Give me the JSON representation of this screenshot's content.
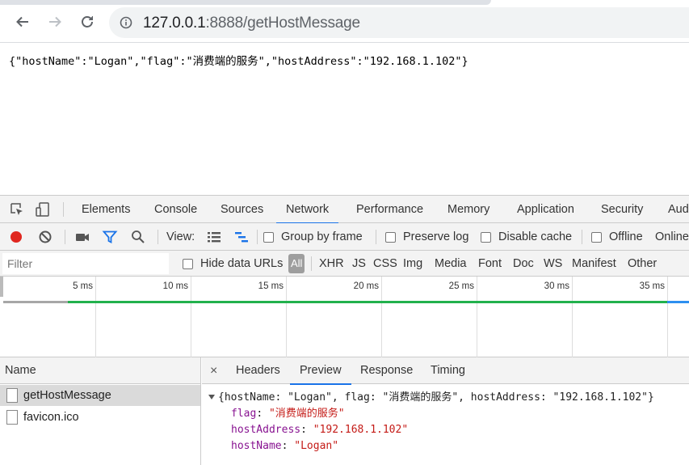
{
  "browser": {
    "url_host": "127.0.0.1",
    "url_path": ":8888/getHostMessage"
  },
  "page": {
    "json_text": "{\"hostName\":\"Logan\",\"flag\":\"消费端的服务\",\"hostAddress\":\"192.168.1.102\"}"
  },
  "devtools": {
    "tabs": [
      "Elements",
      "Console",
      "Sources",
      "Network",
      "Performance",
      "Memory",
      "Application",
      "Security",
      "Aud"
    ],
    "active_tab": "Network",
    "toolbar": {
      "view_label": "View:",
      "group_by_frame": "Group by frame",
      "preserve_log": "Preserve log",
      "disable_cache": "Disable cache",
      "offline": "Offline",
      "online": "Online"
    },
    "filter": {
      "placeholder": "Filter",
      "hide_data_urls": "Hide data URLs",
      "types": [
        "All",
        "XHR",
        "JS",
        "CSS",
        "Img",
        "Media",
        "Font",
        "Doc",
        "WS",
        "Manifest",
        "Other"
      ]
    },
    "timeline_ticks": [
      "5 ms",
      "10 ms",
      "15 ms",
      "20 ms",
      "25 ms",
      "30 ms",
      "35 ms"
    ],
    "requests": {
      "header": "Name",
      "items": [
        "getHostMessage",
        "favicon.ico"
      ]
    },
    "detail": {
      "close": "×",
      "tabs": [
        "Headers",
        "Preview",
        "Response",
        "Timing"
      ],
      "active_tab": "Preview",
      "preview_summary": "{hostName: \"Logan\", flag: \"消费端的服务\", hostAddress: \"192.168.1.102\"}",
      "fields": [
        {
          "key": "flag",
          "value": "\"消费端的服务\""
        },
        {
          "key": "hostAddress",
          "value": "\"192.168.1.102\""
        },
        {
          "key": "hostName",
          "value": "\"Logan\""
        }
      ]
    }
  }
}
